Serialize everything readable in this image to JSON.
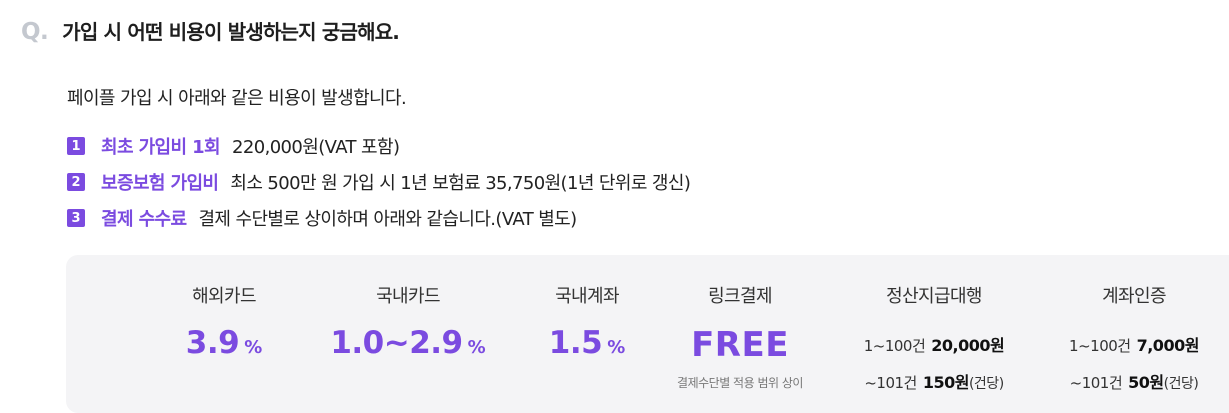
{
  "question": {
    "mark": "Q.",
    "title": "가입 시 어떤 비용이 발생하는지 궁금해요."
  },
  "intro": "페이플 가입 시 아래와 같은 비용이 발생합니다.",
  "items": [
    {
      "num": "1",
      "label": "최초 가입비 1회",
      "desc": "220,000원(VAT 포함)"
    },
    {
      "num": "2",
      "label": "보증보험 가입비",
      "desc": "최소 500만 원 가입 시 1년 보험료 35,750원(1년 단위로 갱신)"
    },
    {
      "num": "3",
      "label": "결제 수수료",
      "desc": "결제 수단별로 상이하며 아래와 같습니다.(VAT 별도)"
    }
  ],
  "fees": {
    "foreign_card": {
      "title": "해외카드",
      "rate": "3.9",
      "unit": "%"
    },
    "domestic_card": {
      "title": "국내카드",
      "rate": "1.0~2.9",
      "unit": "%"
    },
    "domestic_account": {
      "title": "국내계좌",
      "rate": "1.5",
      "unit": "%"
    },
    "link_payment": {
      "title": "링크결제",
      "rate": "FREE",
      "note": "결제수단별 적용 범위 상이"
    },
    "settlement": {
      "title": "정산지급대행",
      "tier1_range": "1~100건",
      "tier1_price": "20,000원",
      "tier2_range": "~101건",
      "tier2_price": "150원",
      "tier2_unit": "(건당)"
    },
    "account_verification": {
      "title": "계좌인증",
      "tier1_range": "1~100건",
      "tier1_price": "7,000원",
      "tier2_range": "~101건",
      "tier2_price": "50원",
      "tier2_unit": "(건당)"
    }
  },
  "colors": {
    "accent": "#7b4be0",
    "box_bg": "#f4f4f6",
    "q_mark": "#c4c8cf"
  }
}
